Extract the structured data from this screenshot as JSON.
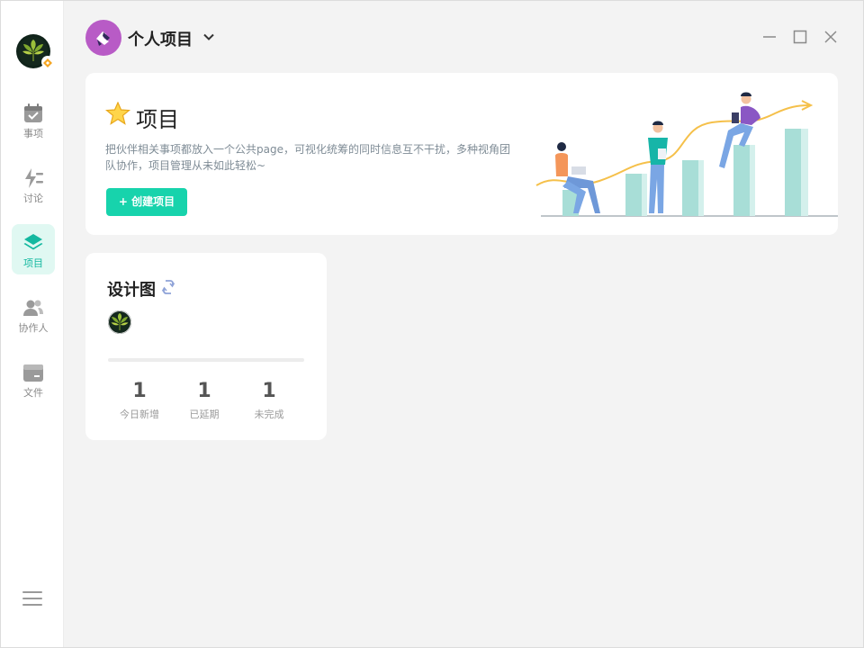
{
  "sidebar": {
    "items": [
      {
        "label": "事项",
        "icon": "calendar-check-icon"
      },
      {
        "label": "讨论",
        "icon": "lightning-discussion-icon"
      },
      {
        "label": "项目",
        "icon": "layers-icon",
        "active": true
      },
      {
        "label": "协作人",
        "icon": "users-icon"
      },
      {
        "label": "文件",
        "icon": "folder-icon"
      }
    ],
    "menu_icon": "hamburger-menu-icon"
  },
  "header": {
    "project_name": "个人项目",
    "dropdown_icon": "chevron-down-icon",
    "window_controls": [
      "minimize-icon",
      "maximize-icon",
      "close-icon"
    ]
  },
  "banner": {
    "title": "项目",
    "description": "把伙伴相关事项都放入一个公共page，可视化统筹的同时信息互不干扰，多种视角团队协作，项目管理从未如此轻松~",
    "create_button": "+ 创建项目"
  },
  "project_card": {
    "title": "设计图",
    "progress": 0,
    "stats": [
      {
        "value": "1",
        "label": "今日新增"
      },
      {
        "value": "1",
        "label": "已延期"
      },
      {
        "value": "1",
        "label": "未完成"
      }
    ]
  },
  "colors": {
    "accent": "#17d3ac",
    "active_nav_bg": "#e0f8f2",
    "project_logo": "#b85bc6",
    "background": "#f3f3f3"
  }
}
